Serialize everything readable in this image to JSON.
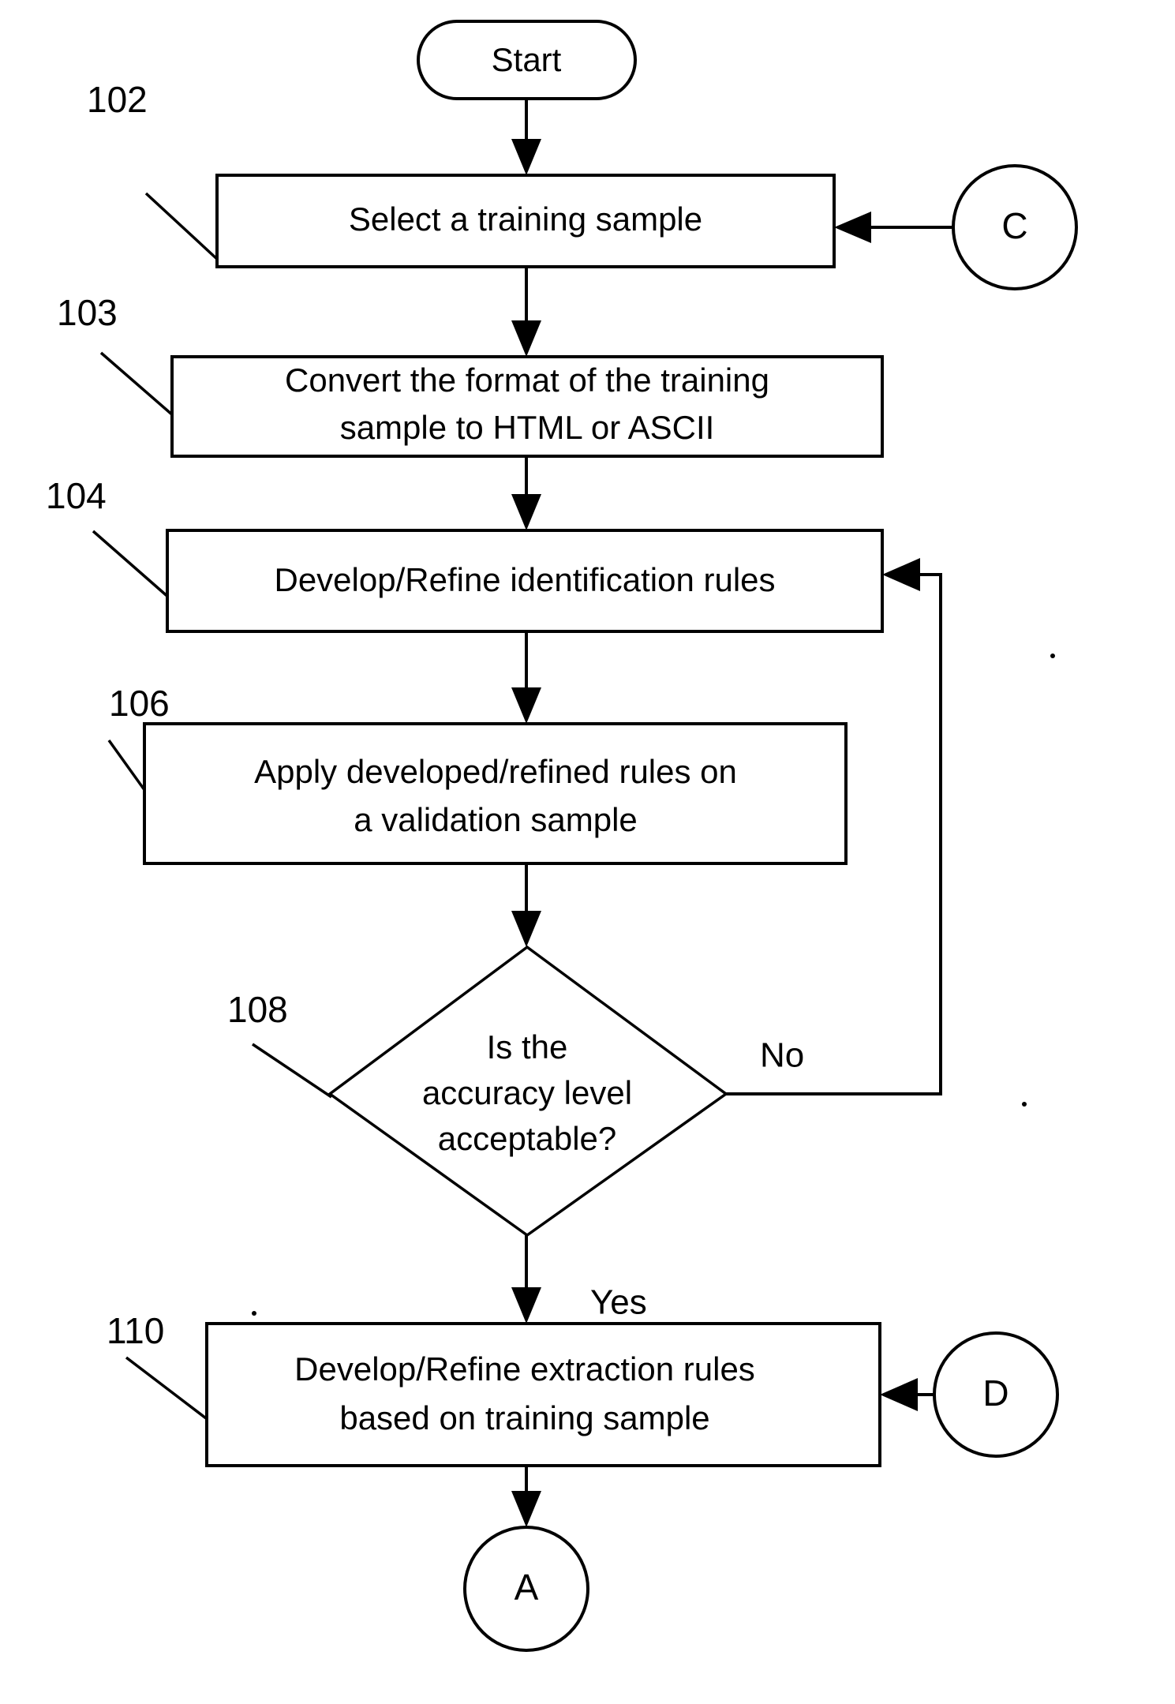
{
  "figure": {
    "type": "flowchart",
    "orientation": "vertical",
    "background_color": "#ffffff",
    "line_color": "#000000"
  },
  "nodes": {
    "start": {
      "shape": "stadium",
      "label": "Start"
    },
    "step_102": {
      "shape": "process",
      "ref": "102",
      "label": "Select a training sample"
    },
    "step_103": {
      "shape": "process",
      "ref": "103",
      "line1": "Convert the format of the training",
      "line2": "sample to HTML or ASCII"
    },
    "step_104": {
      "shape": "process",
      "ref": "104",
      "label": "Develop/Refine identification rules"
    },
    "step_106": {
      "shape": "process",
      "ref": "106",
      "line1": "Apply developed/refined rules on",
      "line2": "a validation sample"
    },
    "decision_108": {
      "shape": "diamond",
      "ref": "108",
      "line1": "Is the",
      "line2": "accuracy level",
      "line3": "acceptable?"
    },
    "step_110": {
      "shape": "process",
      "ref": "110",
      "line1": "Develop/Refine extraction rules",
      "line2": "based on training sample"
    },
    "connector_c": {
      "shape": "circle",
      "label": "C"
    },
    "connector_d": {
      "shape": "circle",
      "label": "D"
    },
    "connector_a": {
      "shape": "circle",
      "label": "A"
    }
  },
  "edge_labels": {
    "no": "No",
    "yes": "Yes"
  }
}
